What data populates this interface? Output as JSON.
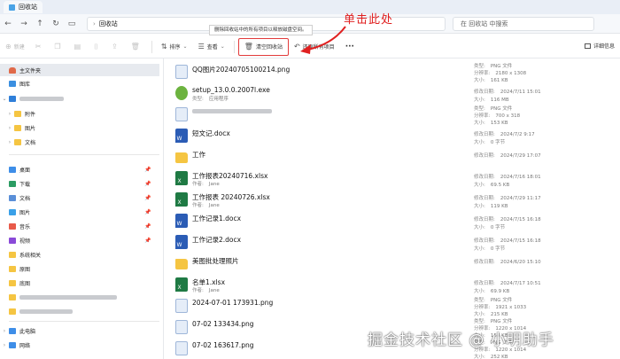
{
  "window": {
    "tab_title": "回收站"
  },
  "address": {
    "path": "回收站",
    "search_placeholder": "在 回收站 中搜索"
  },
  "toolbar": {
    "new_label": "新建",
    "sort_label": "排序",
    "view_label": "查看",
    "empty_label": "清空回收站",
    "restore_all_label": "还原所有项目",
    "more_label": "···",
    "details_label": "详细信息",
    "tooltip": "删除回收站中的所有项目以释放磁盘空间。"
  },
  "annotation": {
    "callout": "单击此处"
  },
  "sidebar": {
    "home": "主文件夹",
    "gallery": "图库",
    "folders": [
      "附件",
      "图片",
      "文档"
    ],
    "quick": [
      "桌面",
      "下载",
      "文档",
      "图片",
      "音乐",
      "视频",
      "系统相关",
      "原图",
      "底图"
    ],
    "this_pc": "此电脑",
    "network": "网络"
  },
  "labels": {
    "type": "类型:",
    "resolution": "分辨率:",
    "author": "作者:",
    "modified": "修改日期:",
    "size": "大小:"
  },
  "files": [
    {
      "name": "QQ图片20240705100214.png",
      "icon": "img",
      "type": "PNG 文件",
      "res": "2180 x 1308",
      "size": "161 KB"
    },
    {
      "name": "setup_13.0.0.2007l.exe",
      "icon": "exe",
      "type": "应用程序",
      "modified": "2024/7/11 15:01",
      "size": "116 MB"
    },
    {
      "name": "",
      "icon": "img",
      "type": "PNG 文件",
      "res": "700 x 318",
      "size": "153 KB",
      "blurred": true
    },
    {
      "name": "短文记.docx",
      "icon": "doc",
      "modified": "2024/7/2 9:17",
      "size": "0 字节"
    },
    {
      "name": "工作",
      "icon": "folder",
      "modified": "2024/7/29 17:07"
    },
    {
      "name": "工作报表20240716.xlsx",
      "icon": "xls",
      "author": "Jane",
      "modified": "2024/7/16 18:01",
      "size": "69.5 KB"
    },
    {
      "name": "工作报表 20240726.xlsx",
      "icon": "xls",
      "author": "Jane",
      "modified": "2024/7/29 11:17",
      "size": "119 KB"
    },
    {
      "name": "工作记录1.docx",
      "icon": "doc",
      "modified": "2024/7/15 16:18",
      "size": "0 字节"
    },
    {
      "name": "工作记录2.docx",
      "icon": "doc",
      "modified": "2024/7/15 16:18",
      "size": "0 字节"
    },
    {
      "name": "美图批处理照片",
      "icon": "folder",
      "modified": "2024/6/20 15:10"
    },
    {
      "name": "名单1.xlsx",
      "icon": "xls",
      "author": "Jane",
      "modified": "2024/7/17 10:51",
      "size": "69.9 KB"
    },
    {
      "name": "2024-07-01 173931.png",
      "icon": "img",
      "type": "PNG 文件",
      "res": "1921 x 1033",
      "size": "215 KB"
    },
    {
      "name": "07-02 133434.png",
      "icon": "img",
      "type": "PNG 文件",
      "res": "1220 x 1014",
      "size": "158 KB"
    },
    {
      "name": "07-02 163617.png",
      "icon": "img",
      "type": "PNG 文件",
      "res": "1220 x 1014",
      "size": "252 KB"
    }
  ],
  "watermark": "掘金技术社区 @ 小明助手",
  "colors": {
    "accent_red": "#e02020",
    "folder": "#f5c542",
    "word": "#2b5cb5",
    "excel": "#1f7a44"
  }
}
